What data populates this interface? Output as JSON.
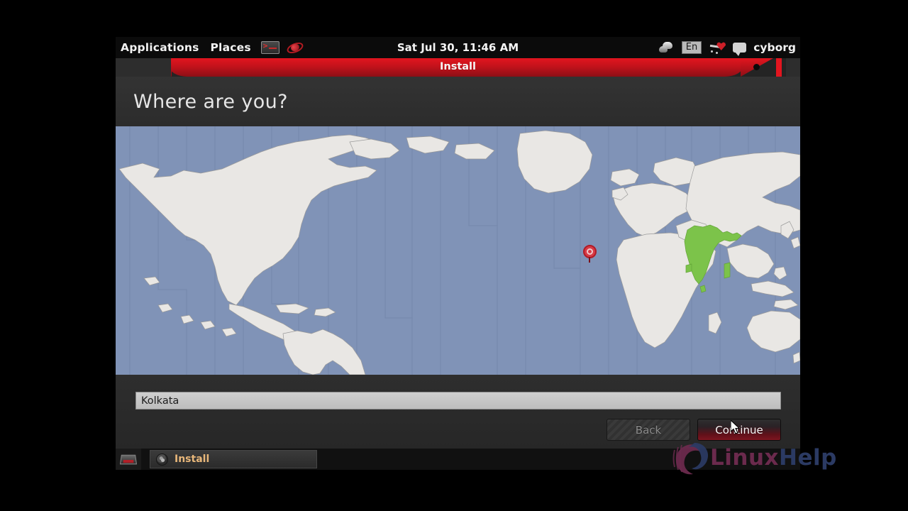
{
  "desktop": {
    "panel_top": {
      "menus": [
        {
          "label": "Applications",
          "name": "menu-applications"
        },
        {
          "label": "Places",
          "name": "menu-places"
        }
      ],
      "launchers": [
        {
          "icon": "terminal-icon",
          "label": "Terminal"
        },
        {
          "icon": "browser-swirl-icon",
          "label": "Web Browser"
        }
      ],
      "clock": "Sat Jul 30, 11:46 AM",
      "tray": {
        "updates_icon": "updates-icon",
        "keyboard_layout": "En",
        "volume_icon": "volume-icon",
        "chat_icon": "chat-bubble-icon",
        "username": "cyborg"
      }
    },
    "panel_bottom": {
      "show_desktop_icon": "show-desktop-icon",
      "tasks": [
        {
          "icon": "cd-disc-icon",
          "label": "Install"
        }
      ]
    },
    "watermark": {
      "part1": "Linux",
      "part2": "Help",
      "logo_icon": "linuxhelp-swirl-icon"
    }
  },
  "window": {
    "title": "Install",
    "close_button": "close-dot",
    "heading": "Where are you?",
    "map": {
      "ocean_color": "#8093b7",
      "land_color": "#e9e7e4",
      "highlight_color": "#7cc34a",
      "marker_color": "#d83b46",
      "marker_label": "selected-location-marker",
      "highlighted_country": "India"
    },
    "location_field": {
      "value": "Kolkata",
      "placeholder": "Kolkata"
    },
    "buttons": {
      "back": "Back",
      "continue": "Continue"
    }
  },
  "colors": {
    "titlebar_red": "#e2151f",
    "window_bg": "#2b2b2b",
    "accent_red": "#b01b26",
    "task_label": "#e8b77a"
  }
}
